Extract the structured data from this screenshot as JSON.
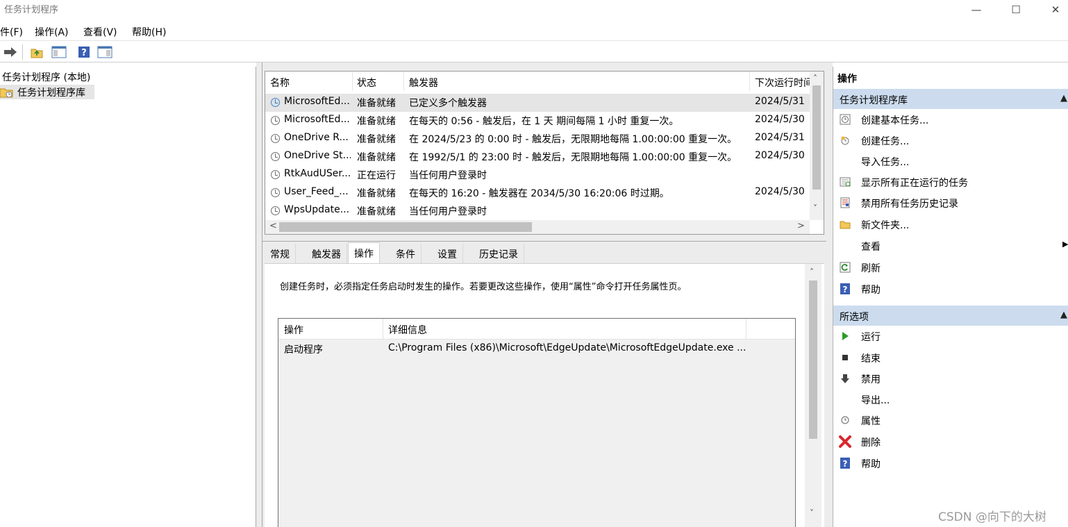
{
  "window": {
    "title": "任务计划程序",
    "minimize_glyph": "—",
    "maximize_glyph": "☐",
    "close_glyph": "✕"
  },
  "menu": [
    "件(F)",
    "操作(A)",
    "查看(V)",
    "帮助(H)"
  ],
  "toolbar": {
    "icons": [
      "forward-arrow-icon",
      "folder-up-icon",
      "show-hide-console-tree-icon",
      "help-icon",
      "show-hide-action-pane-icon"
    ]
  },
  "tree": {
    "root": "任务计划程序 (本地)",
    "library": "任务计划程序库"
  },
  "tasklist": {
    "columns": [
      "名称",
      "状态",
      "触发器",
      "下次运行时间"
    ],
    "rows": [
      {
        "name": "MicrosoftEd...",
        "status": "准备就绪",
        "trigger": "已定义多个触发器",
        "next": "2024/5/31"
      },
      {
        "name": "MicrosoftEd...",
        "status": "准备就绪",
        "trigger": "在每天的 0:56 - 触发后，在 1 天 期间每隔 1 小时 重复一次。",
        "next": "2024/5/30"
      },
      {
        "name": "OneDrive R...",
        "status": "准备就绪",
        "trigger": "在 2024/5/23 的 0:00 时 - 触发后，无限期地每隔 1.00:00:00 重复一次。",
        "next": "2024/5/31"
      },
      {
        "name": "OneDrive St...",
        "status": "准备就绪",
        "trigger": "在 1992/5/1 的 23:00 时 - 触发后，无限期地每隔 1.00:00:00 重复一次。",
        "next": "2024/5/30"
      },
      {
        "name": "RtkAudUSer...",
        "status": "正在运行",
        "trigger": "当任何用户登录时",
        "next": ""
      },
      {
        "name": "User_Feed_...",
        "status": "准备就绪",
        "trigger": "在每天的 16:20 - 触发器在 2034/5/30 16:20:06 时过期。",
        "next": "2024/5/30"
      },
      {
        "name": "WpsUpdate...",
        "status": "准备就绪",
        "trigger": "当任何用户登录时",
        "next": ""
      }
    ],
    "scroll_up": "˄",
    "scroll_down": "˅",
    "scroll_left": "<",
    "scroll_right": ">"
  },
  "tabs": [
    "常规",
    "触发器",
    "操作",
    "条件",
    "设置",
    "历史记录"
  ],
  "detail": {
    "description": "创建任务时，必须指定任务启动时发生的操作。若要更改这些操作，使用“属性”命令打开任务属性页。",
    "columns": [
      "操作",
      "详细信息"
    ],
    "rows": [
      {
        "action": "启动程序",
        "details": "C:\\Program Files (x86)\\Microsoft\\EdgeUpdate\\MicrosoftEdgeUpdate.exe ..."
      }
    ]
  },
  "actions": {
    "title": "操作",
    "section1": {
      "title": "任务计划程序库",
      "items": [
        "创建基本任务...",
        "创建任务...",
        "导入任务...",
        "显示所有正在运行的任务",
        "禁用所有任务历史记录",
        "新文件夹...",
        "查看",
        "刷新",
        "帮助"
      ]
    },
    "section2": {
      "title": "所选项",
      "items": [
        "运行",
        "结束",
        "禁用",
        "导出...",
        "属性",
        "删除",
        "帮助"
      ]
    }
  },
  "watermark": "CSDN @向下的大树"
}
